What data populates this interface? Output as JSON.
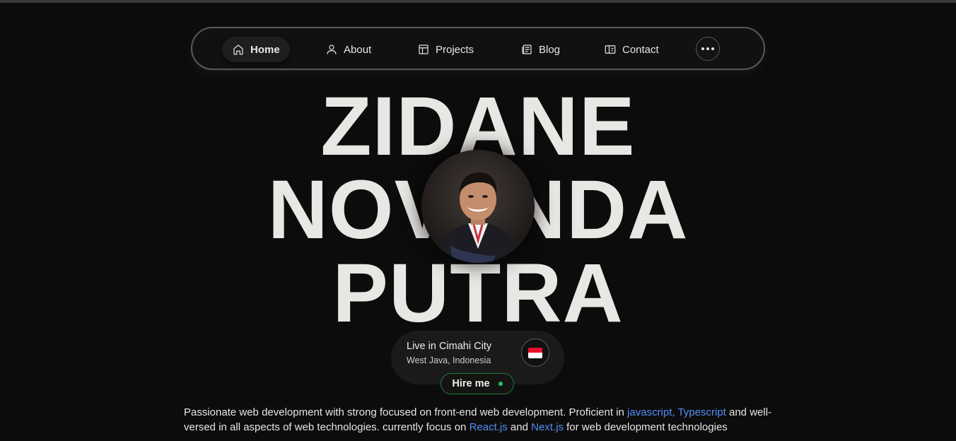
{
  "nav": {
    "items": [
      {
        "label": "Home",
        "icon": "home-icon",
        "active": true
      },
      {
        "label": "About",
        "icon": "user-icon"
      },
      {
        "label": "Projects",
        "icon": "layout-icon"
      },
      {
        "label": "Blog",
        "icon": "newspaper-icon"
      },
      {
        "label": "Contact",
        "icon": "id-card-icon"
      }
    ],
    "more_icon": "more-horizontal-icon"
  },
  "hero": {
    "name_line1": "ZIDANE",
    "name_line2": "NOVANDA",
    "name_line3": "PUTRA"
  },
  "location": {
    "city": "Live in Cimahi City",
    "region": "West Java, Indonesia",
    "flag_icon": "indonesia-flag-icon"
  },
  "hire": {
    "label": "Hire me",
    "status_color": "#22c55e"
  },
  "bio": {
    "part1": "Passionate web development with strong focused on front-end web development. Proficient in ",
    "link1": "javascript, Typescript",
    "part2": " and well-versed in all aspects of web technologies. currently focus on ",
    "link2": "React.js",
    "part3": " and ",
    "link3": "Next.js",
    "part4": " for web development technologies"
  },
  "colors": {
    "background": "#0d0c0c",
    "link": "#4f8ff7",
    "text": "#e8e6e3"
  }
}
